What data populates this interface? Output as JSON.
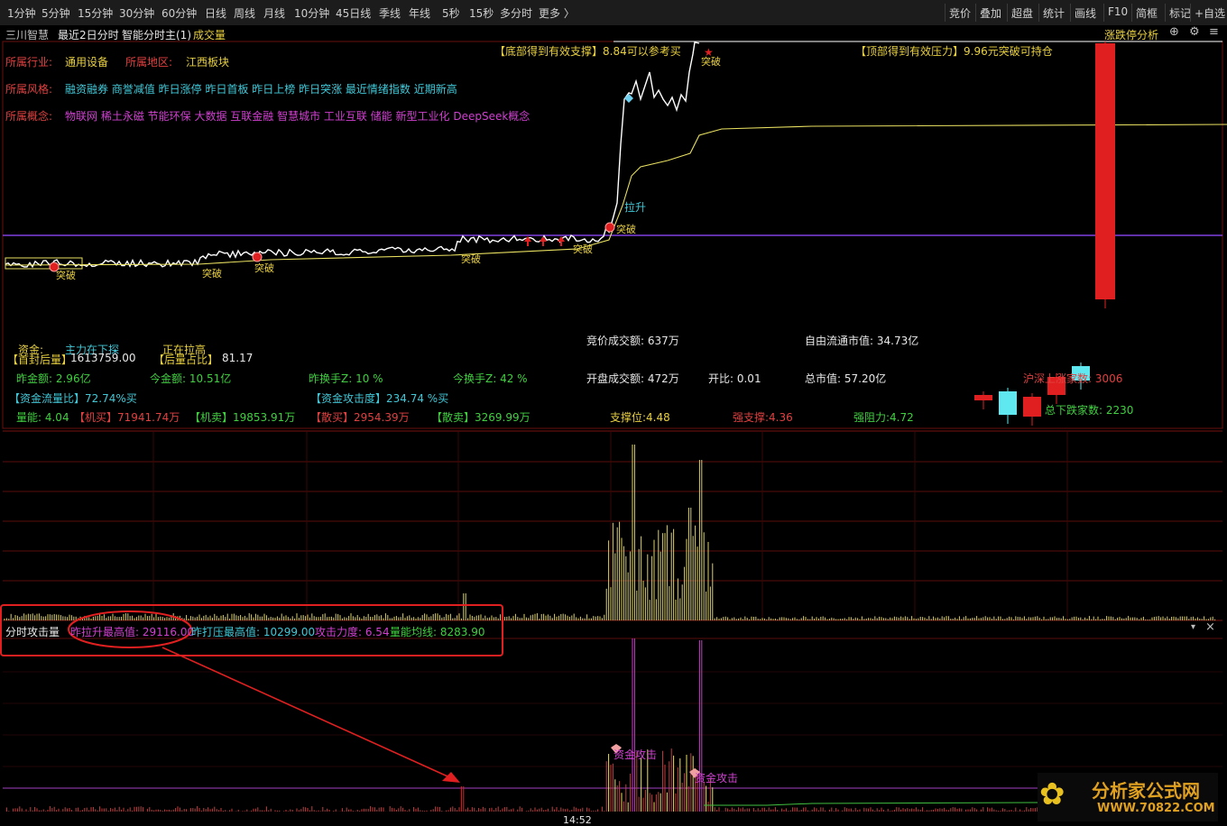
{
  "toolbar": {
    "periods": [
      "1分钟",
      "5分钟",
      "15分钟",
      "30分钟",
      "60分钟",
      "日线",
      "周线",
      "月线",
      "10分钟",
      "45日线",
      "季线",
      "年线",
      "5秒",
      "15秒",
      "多分时",
      "更多 〉"
    ],
    "right_tools": [
      "竞价",
      "叠加",
      "超盘",
      "统计",
      "画线",
      "F10",
      "简框",
      "标记",
      "+自选"
    ]
  },
  "title": {
    "stock": "三川智慧",
    "mode": "最近2日分时",
    "indicator": "智能分时主(1)",
    "sub": "成交量",
    "right_link": "涨跌停分析"
  },
  "info": {
    "industry_label": "所属行业:",
    "industry": "通用设备",
    "region_label": "所属地区:",
    "region": "江西板块",
    "style_label": "所属风格:",
    "style": "融资融券 商誉减值 昨日涨停 昨日首板 昨日上榜 昨日突涨 最近情绪指数 近期新高",
    "concept_label": "所属概念:",
    "concept": "物联网 稀土永磁 节能环保 大数据 互联金融 智慧城市 工业互联 储能 新型工业化 DeepSeek概念"
  },
  "chart_notes": {
    "support": "【底部得到有效支撑】8.84可以参考买",
    "pressure": "【顶部得到有效压力】9.96元突破可持仓",
    "breakthrough": "突破",
    "pull": "拉升"
  },
  "stats": {
    "fund_label": "资金:",
    "fund_value": "主力在下探",
    "pulling": "正在拉高",
    "first_seal_label": "【首封后量】",
    "first_seal": "1613759.00",
    "after_ratio_label": "【后量占比】",
    "after_ratio": "81.17",
    "auction_amount": "竞价成交额: 637万",
    "free_cap": "自由流通市值: 34.73亿",
    "prev_amount": "昨金额: 2.96亿",
    "today_amount": "今金额: 10.51亿",
    "prev_turnover": "昨换手Z:  10  %",
    "today_turnover": "今换手Z:  42  %",
    "open_amount": "开盘成交额: 472万",
    "open_ratio": "开比: 0.01",
    "total_cap": "总市值: 57.20亿",
    "sh_sz_up": "沪深上涨家数:  3006",
    "sh_sz_down": "总下跌家数:  2230",
    "flow_ratio": "【资金流量比】72.74%买",
    "attack_degree": "【资金攻击度】234.74 %买",
    "vol_energy": "量能: 4.04",
    "inst_buy": "【机买】71941.74万",
    "inst_sell": "【机卖】19853.91万",
    "retail_buy": "【散买】2954.39万",
    "retail_sell": "【散卖】3269.99万",
    "support_pos": "支撑位:4.48",
    "strong_support": "强支撑:4.36",
    "strong_resist": "强阻力:4.72"
  },
  "attack": {
    "title": "分时攻击量",
    "prev_pull_max": "昨拉升最高值: 29116.00",
    "prev_press_max": "昨打压最高值: 10299.00",
    "attack_power": "攻击力度: 6.54",
    "vol_avg": "量能均线: 8283.90",
    "fund_attack": "资金攻击",
    "time_label": "14:52"
  },
  "logo": {
    "name": "分析家公式网",
    "url": "WWW.70822.COM"
  },
  "colors": {
    "price_line": "#ffffff",
    "avg_line": "#e8e060",
    "prev_close": "#8040e0",
    "volume": "#d8d070",
    "candle_up": "#e02020",
    "candle_down": "#60e8f0",
    "attack_bar": "#c040c0",
    "annotation": "#e02020"
  }
}
